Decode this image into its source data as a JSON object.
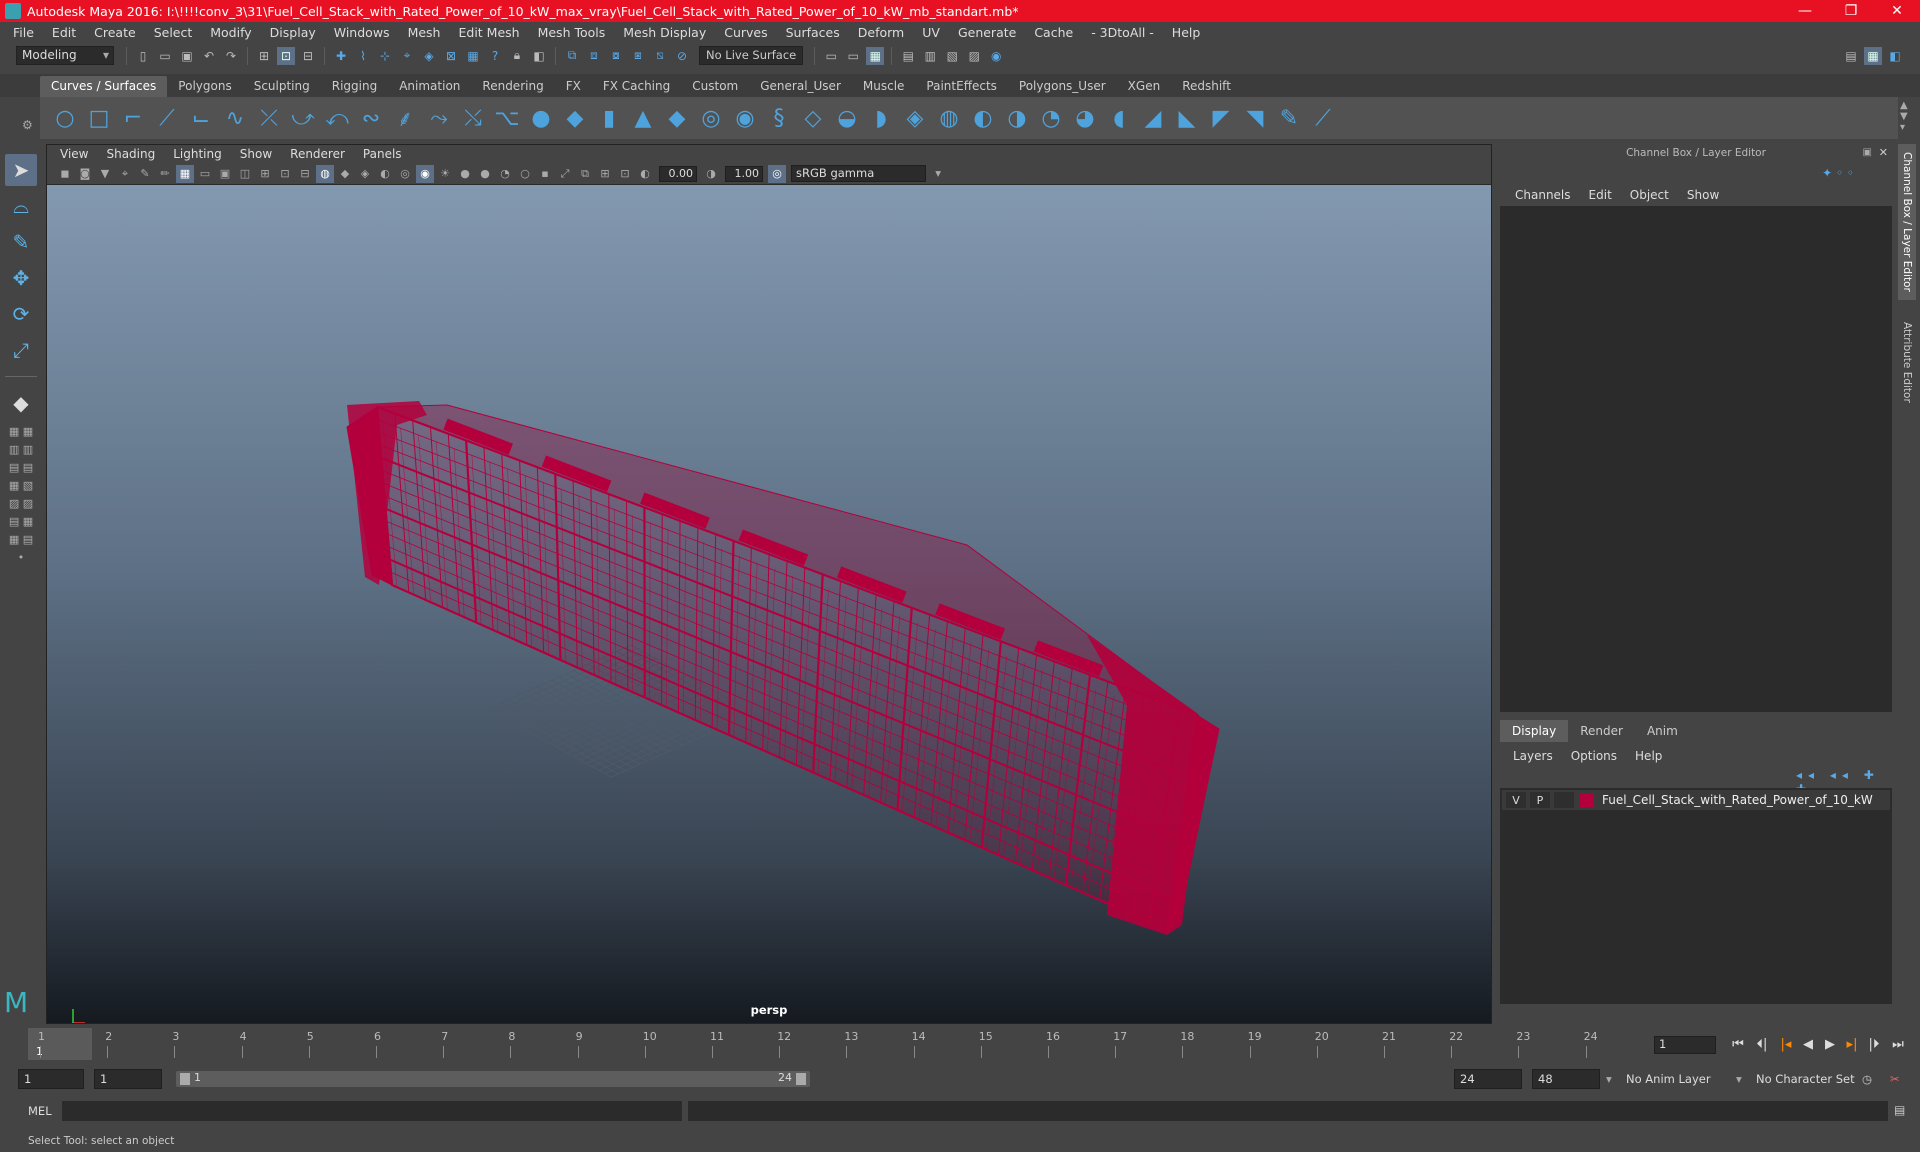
{
  "window": {
    "title": "Autodesk Maya 2016: I:\\!!!!conv_3\\31\\Fuel_Cell_Stack_with_Rated_Power_of_10_kW_max_vray\\Fuel_Cell_Stack_with_Rated_Power_of_10_kW_mb_standart.mb*",
    "minimize": "—",
    "restore": "❐",
    "close": "✕"
  },
  "menubar": [
    "File",
    "Edit",
    "Create",
    "Select",
    "Modify",
    "Display",
    "Windows",
    "Mesh",
    "Edit Mesh",
    "Mesh Tools",
    "Mesh Display",
    "Curves",
    "Surfaces",
    "Deform",
    "UV",
    "Generate",
    "Cache",
    "- 3DtoAll -",
    "Help"
  ],
  "statusline": {
    "mode": "Modeling",
    "live_surface": "No Live Surface"
  },
  "shelf": {
    "tabs": [
      "Curves / Surfaces",
      "Polygons",
      "Sculpting",
      "Rigging",
      "Animation",
      "Rendering",
      "FX",
      "FX Caching",
      "Custom",
      "General_User",
      "Muscle",
      "PaintEffects",
      "Polygons_User",
      "XGen",
      "Redshift"
    ],
    "active_tab": "Curves / Surfaces"
  },
  "viewport": {
    "menu": [
      "View",
      "Shading",
      "Lighting",
      "Show",
      "Renderer",
      "Panels"
    ],
    "exposure": "0.00",
    "gamma": "1.00",
    "color_space": "sRGB gamma",
    "camera": "persp",
    "wire_color": "#b3003c"
  },
  "right_panel": {
    "header": "Channel Box / Layer Editor",
    "channel_menu": [
      "Channels",
      "Edit",
      "Object",
      "Show"
    ],
    "lower_tabs": [
      "Display",
      "Render",
      "Anim"
    ],
    "active_lower_tab": "Display",
    "layer_menu": [
      "Layers",
      "Options",
      "Help"
    ],
    "layer": {
      "v": "V",
      "p": "P",
      "name": "Fuel_Cell_Stack_with_Rated_Power_of_10_kW",
      "color": "#b3003c"
    },
    "side_tabs": [
      "Channel Box / Layer Editor",
      "Attribute Editor"
    ]
  },
  "timeline": {
    "ticks": [
      "1",
      "2",
      "3",
      "4",
      "5",
      "6",
      "7",
      "8",
      "9",
      "10",
      "11",
      "12",
      "13",
      "14",
      "15",
      "16",
      "17",
      "18",
      "19",
      "20",
      "21",
      "22",
      "23",
      "24"
    ],
    "current_frame": "1",
    "frame_field": "1"
  },
  "range": {
    "start": "1",
    "playback_start": "1",
    "slider_start": "1",
    "slider_end": "24",
    "playback_end": "24",
    "end": "48",
    "anim_layer": "No Anim Layer",
    "character_set": "No Character Set"
  },
  "command": {
    "lang": "MEL"
  },
  "status": {
    "help_line": "Select Tool: select an object"
  }
}
